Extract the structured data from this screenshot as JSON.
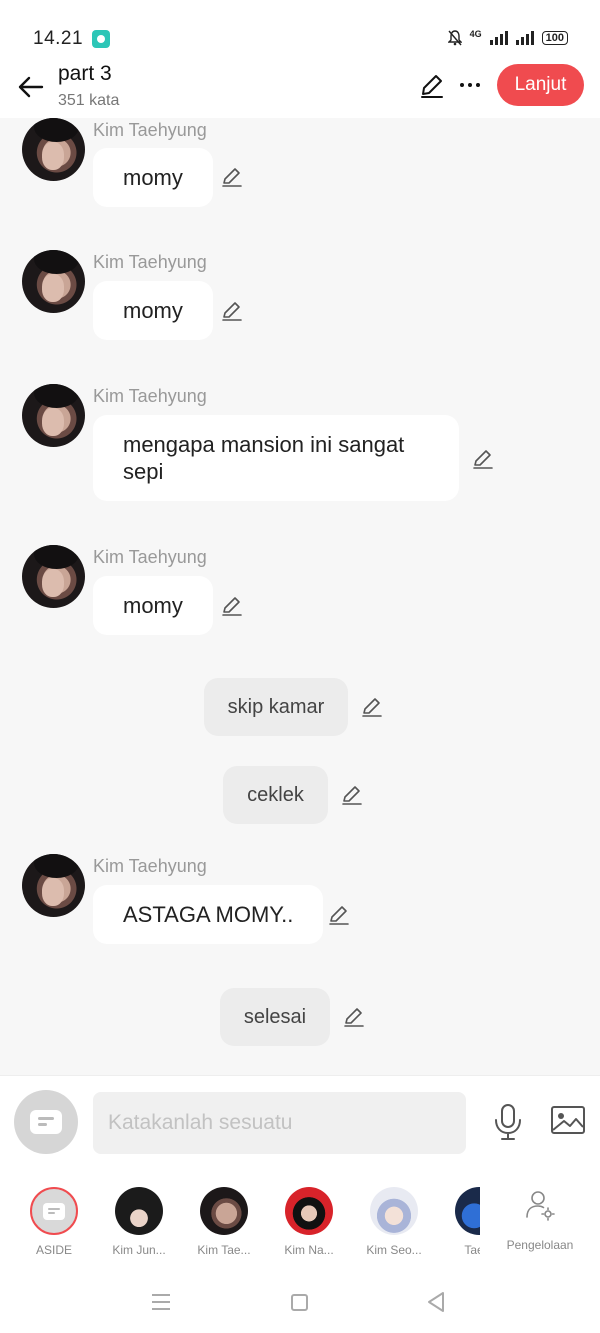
{
  "status_bar": {
    "time": "14.21",
    "network": "4G",
    "battery": "100"
  },
  "header": {
    "title": "part 3",
    "word_count": "351 kata",
    "next_button": "Lanjut"
  },
  "messages": [
    {
      "type": "character",
      "name": "Kim Taehyung",
      "text": "momy"
    },
    {
      "type": "character",
      "name": "Kim Taehyung",
      "text": "momy"
    },
    {
      "type": "character",
      "name": "Kim Taehyung",
      "text": "mengapa mansion ini sangat sepi"
    },
    {
      "type": "character",
      "name": "Kim Taehyung",
      "text": "momy"
    },
    {
      "type": "narration",
      "text": "skip kamar"
    },
    {
      "type": "narration",
      "text": "ceklek"
    },
    {
      "type": "character",
      "name": "Kim Taehyung",
      "text": "ASTAGA MOMY.."
    },
    {
      "type": "narration",
      "text": "selesai"
    }
  ],
  "input": {
    "placeholder": "Katakanlah sesuatu"
  },
  "characters": [
    {
      "label": "ASIDE"
    },
    {
      "label": "Kim Jun..."
    },
    {
      "label": "Kim Tae..."
    },
    {
      "label": "Kim Na..."
    },
    {
      "label": "Kim Seo..."
    },
    {
      "label": "Tae h"
    }
  ],
  "manage_label": "Pengelolaan",
  "colors": {
    "accent": "#f04b4f",
    "background": "#f7f7f7",
    "bubble": "#ffffff",
    "narration_bubble": "#ececec"
  }
}
